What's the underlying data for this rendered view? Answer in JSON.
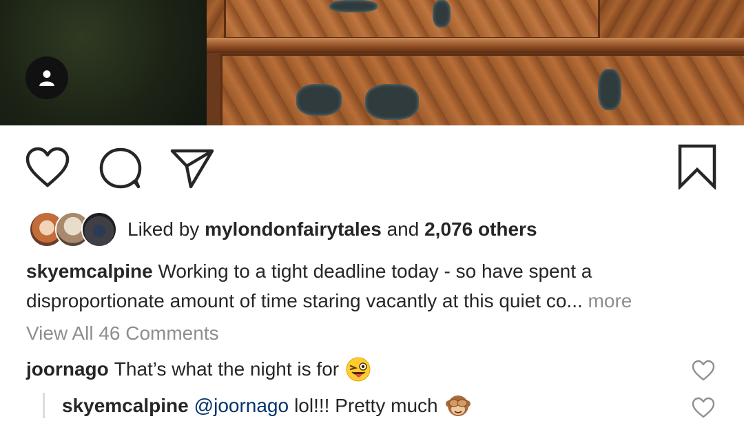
{
  "post": {
    "likes": {
      "prefix": "Liked by",
      "user": "mylondonfairytales",
      "and": "and",
      "count": "2,076 others"
    },
    "caption": {
      "user": "skyemcalpine",
      "text": "Working to a tight deadline today - so have spent a disproportionate amount of time staring vacantly at this quiet co...",
      "more": "more"
    },
    "view_all": "View All 46 Comments",
    "comments": [
      {
        "user": "joornago",
        "text": "That’s what the night is for",
        "emoji": "winking-tongue-face"
      },
      {
        "user": "skyemcalpine",
        "mention": "@joornago",
        "text": "lol!!! Pretty much",
        "emoji": "see-no-evil-monkey"
      }
    ]
  },
  "icons": {
    "like": "heart-icon",
    "comment": "comment-icon",
    "share": "paper-plane-icon",
    "save": "bookmark-icon",
    "user": "user-icon"
  },
  "colors": {
    "text": "#262626",
    "secondary": "#8e8e8e",
    "mention": "#003569",
    "divider": "#dbdbdb"
  }
}
